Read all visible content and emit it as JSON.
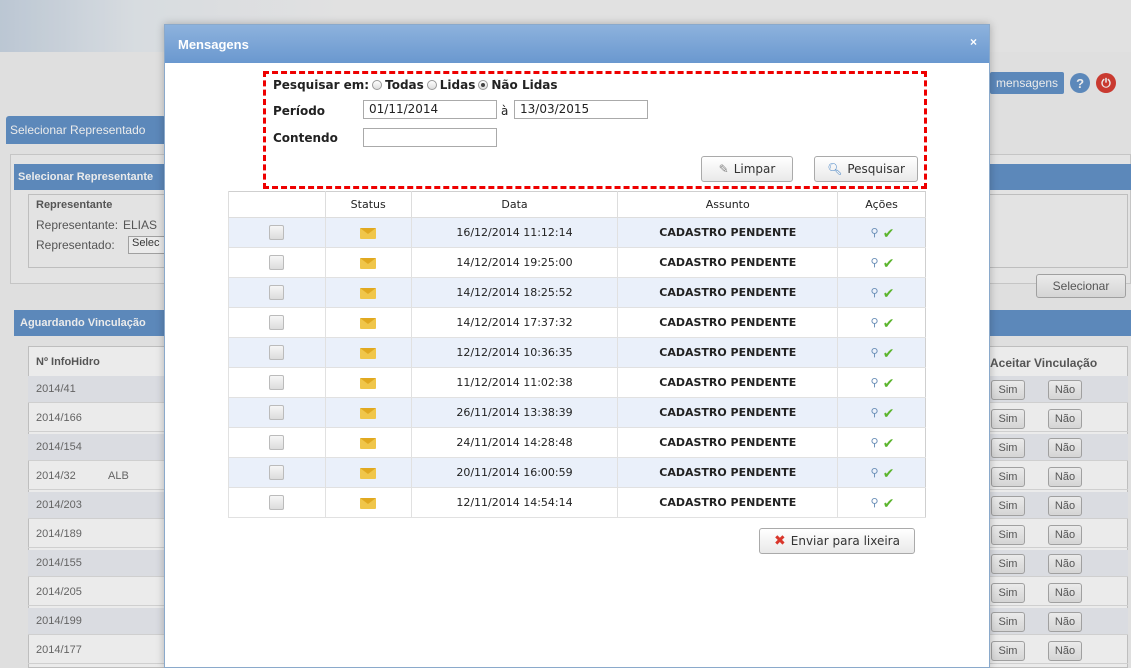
{
  "background": {
    "top_right_messages_label": "mensagens",
    "tab_label": "Selecionar Representado",
    "panel_title": "Selecionar Representante",
    "fieldset_title": "Representante",
    "representante_label": "Representante:",
    "representante_value": "ELIAS",
    "representado_label": "Representado:",
    "representado_value": "Selec",
    "select_button": "Selecionar",
    "linking_panel_title": "Aguardando Vinculação",
    "col_infohidro": "Nº InfoHidro",
    "col_aceitar": "Aceitar Vinculação",
    "sim_label": "Sim",
    "nao_label": "Não",
    "rows": [
      {
        "id": "2014/41",
        "extra": ""
      },
      {
        "id": "2014/166",
        "extra": ""
      },
      {
        "id": "2014/154",
        "extra": ""
      },
      {
        "id": "2014/32",
        "extra": "ALB"
      },
      {
        "id": "2014/203",
        "extra": ""
      },
      {
        "id": "2014/189",
        "extra": ""
      },
      {
        "id": "2014/155",
        "extra": ""
      },
      {
        "id": "2014/205",
        "extra": ""
      },
      {
        "id": "2014/199",
        "extra": ""
      },
      {
        "id": "2014/177",
        "extra": ""
      }
    ]
  },
  "modal": {
    "title": "Mensagens",
    "close": "×",
    "search": {
      "search_in_label": "Pesquisar em:",
      "options": [
        "Todas",
        "Lidas",
        "Não Lidas"
      ],
      "selected": "Não Lidas",
      "period_label": "Período",
      "date_from": "01/11/2014",
      "date_sep": "à",
      "date_to": "13/03/2015",
      "containing_label": "Contendo",
      "containing_value": "",
      "clear_button": "Limpar",
      "search_button": "Pesquisar"
    },
    "table": {
      "headers": [
        "",
        "Status",
        "Data",
        "Assunto",
        "Ações"
      ],
      "rows": [
        {
          "date": "16/12/2014 11:12:14",
          "subject": "CADASTRO PENDENTE"
        },
        {
          "date": "14/12/2014 19:25:00",
          "subject": "CADASTRO PENDENTE"
        },
        {
          "date": "14/12/2014 18:25:52",
          "subject": "CADASTRO PENDENTE"
        },
        {
          "date": "14/12/2014 17:37:32",
          "subject": "CADASTRO PENDENTE"
        },
        {
          "date": "12/12/2014 10:36:35",
          "subject": "CADASTRO PENDENTE"
        },
        {
          "date": "11/12/2014 11:02:38",
          "subject": "CADASTRO PENDENTE"
        },
        {
          "date": "26/11/2014 13:38:39",
          "subject": "CADASTRO PENDENTE"
        },
        {
          "date": "24/11/2014 14:28:48",
          "subject": "CADASTRO PENDENTE"
        },
        {
          "date": "20/11/2014 16:00:59",
          "subject": "CADASTRO PENDENTE"
        },
        {
          "date": "12/11/2014 14:54:14",
          "subject": "CADASTRO PENDENTE"
        }
      ]
    },
    "trash_button": "Enviar para lixeira"
  },
  "colors": {
    "accent": "#5d8fc8",
    "highlight_border": "#e00000",
    "row_alt": "#eaf0fa"
  },
  "icons": {
    "status": "envelope-icon",
    "view": "magnifier-icon",
    "mark": "check-icon",
    "clear": "pencil-eraser-icon",
    "search": "magnifier-icon",
    "trash": "red-x-icon"
  }
}
